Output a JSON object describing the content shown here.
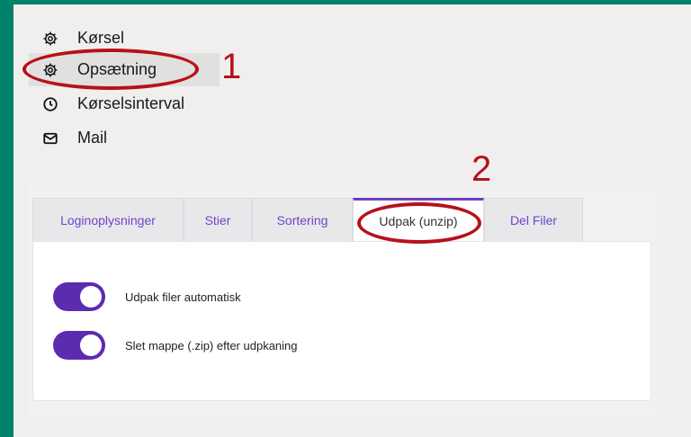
{
  "menu": {
    "items": [
      {
        "label": "Kørsel",
        "icon": "gear-icon"
      },
      {
        "label": "Opsætning",
        "icon": "gear-icon"
      },
      {
        "label": "Kørselsinterval",
        "icon": "clock-icon"
      },
      {
        "label": "Mail",
        "icon": "mail-icon"
      }
    ]
  },
  "callouts": {
    "one": "1",
    "two": "2"
  },
  "tabs": [
    {
      "label": "Loginoplysninger"
    },
    {
      "label": "Stier"
    },
    {
      "label": "Sortering"
    },
    {
      "label": "Udpak (unzip)"
    },
    {
      "label": "Del Filer"
    }
  ],
  "settings": {
    "unzip_auto": {
      "label": "Udpak filer automatisk",
      "on": true
    },
    "delete_folder": {
      "label": "Slet mappe (.zip) efter udpkaning",
      "on": true
    }
  },
  "colors": {
    "accent": "#5b2cb0",
    "frame": "#00826a",
    "callout": "#b5121b"
  }
}
